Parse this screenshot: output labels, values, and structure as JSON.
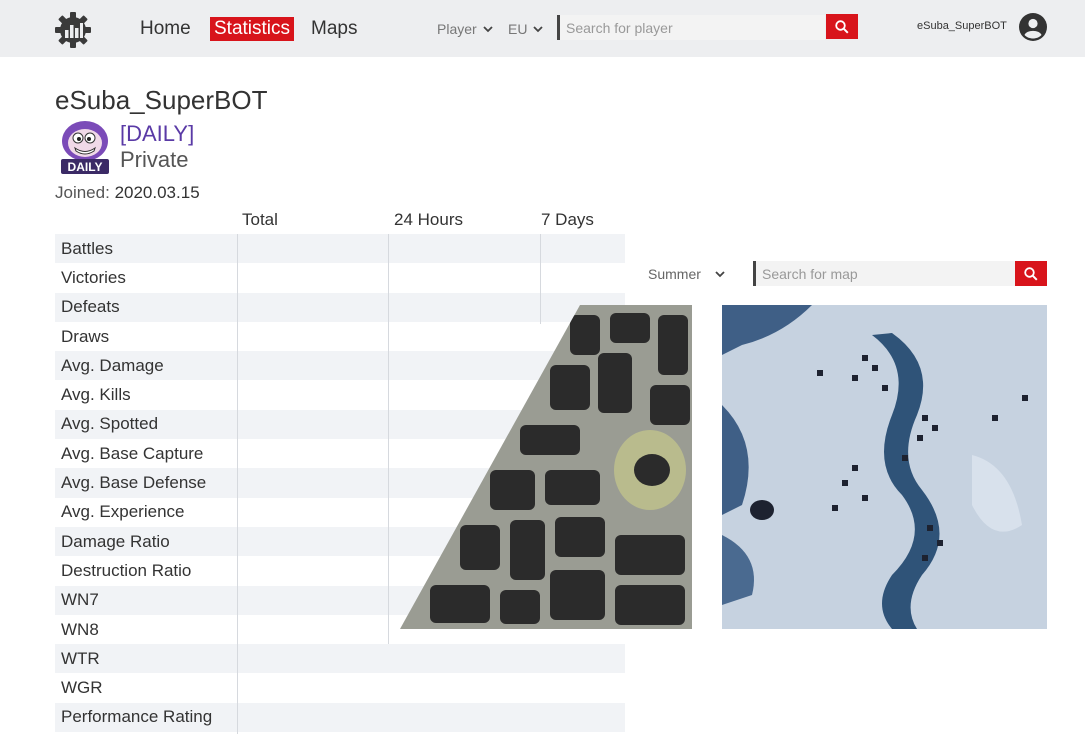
{
  "nav": {
    "home": "Home",
    "statistics": "Statistics",
    "maps": "Maps"
  },
  "search": {
    "type_selected": "Player",
    "region_selected": "EU",
    "player_placeholder": "Search for player"
  },
  "user": {
    "name": "eSuba_SuperBOT"
  },
  "profile": {
    "name": "eSuba_SuperBOT",
    "clan_tag": "[DAILY]",
    "clan_role": "Private",
    "joined_label": "Joined:",
    "joined_date": "2020.03.15",
    "emblem_text": "DAILY"
  },
  "stats": {
    "columns": [
      "Total",
      "24 Hours",
      "7 Days"
    ],
    "rows": [
      "Battles",
      "Victories",
      "Defeats",
      "Draws",
      "Avg. Damage",
      "Avg. Kills",
      "Avg. Spotted",
      "Avg. Base Capture",
      "Avg. Base Defense",
      "Avg. Experience",
      "Damage Ratio",
      "Destruction Ratio",
      "WN7",
      "WN8",
      "WTR",
      "WGR",
      "Performance Rating"
    ]
  },
  "maps": {
    "season_selected": "Summer",
    "search_placeholder": "Search for map"
  },
  "colors": {
    "accent": "#d8141b",
    "topbar": "#edeef0",
    "clan_tag": "#5a3aa6"
  },
  "icons": [
    "gear-chart-logo-icon",
    "chevron-down-icon",
    "search-icon",
    "user-avatar-icon"
  ]
}
